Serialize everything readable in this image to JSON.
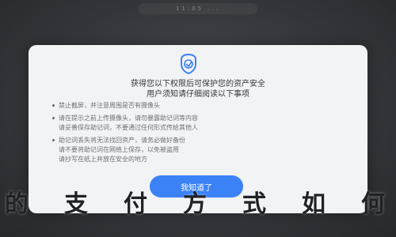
{
  "status_bar": {
    "text": "11:05 ..."
  },
  "dialog": {
    "title_lines": [
      "获得您以下权限后可保护您的资产安全",
      "用户须知请仔细阅读以下事项"
    ],
    "bullets": [
      [
        "禁止截屏，并注意周围是否有摄像头"
      ],
      [
        "请在提示之前上传摄像头，请勿暴露助记词等内容",
        "请妥善保存助记词，不要通过任何形式传给其他人"
      ],
      [
        "助记词丢失将无法找回资产，请务必做好备份",
        "请不要将助记词在网络上保存，以免被盗用",
        "请抄写在纸上并放在安全的地方"
      ]
    ],
    "confirm_label": "我知道了"
  },
  "caption": {
    "chars": [
      "的",
      "支",
      "付",
      "方",
      "式",
      "如",
      "何"
    ]
  },
  "colors": {
    "accent": "#3b82f6",
    "modal_bg": "#f2f3f5"
  },
  "icons": {
    "dialog_icon": "shield-icon"
  }
}
